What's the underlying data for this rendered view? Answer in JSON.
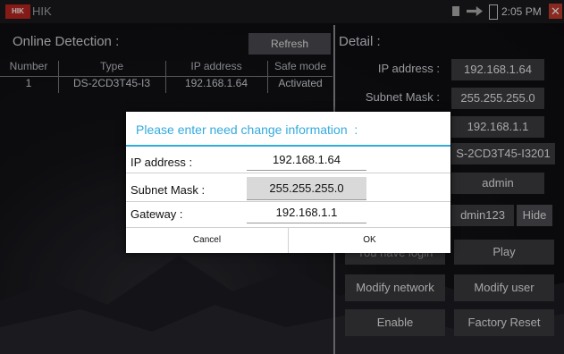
{
  "status_bar": {
    "app_name": "HIK",
    "logo_text": "HIK",
    "time": "2:05 PM"
  },
  "left_panel": {
    "title": "Online Detection :",
    "refresh_label": "Refresh",
    "columns": [
      "Number",
      "Type",
      "IP address",
      "Safe mode"
    ],
    "rows": [
      {
        "number": "1",
        "type": "DS-2CD3T45-I3",
        "ip": "192.168.1.64",
        "safe_mode": "Activated"
      }
    ]
  },
  "detail": {
    "title": "Detail :",
    "ip_label": "IP address :",
    "ip_value": "192.168.1.64",
    "mask_label": "Subnet Mask :",
    "mask_value": "255.255.255.0",
    "gateway_value": "192.168.1.1",
    "device_value": "S-2CD3T45-I3201",
    "user_value": "admin",
    "password_value": "dmin123",
    "hide_label": "Hide",
    "login_status": "You have login",
    "play_label": "Play",
    "modify_network_label": "Modify network",
    "modify_user_label": "Modify user",
    "enable_label": "Enable",
    "factory_reset_label": "Factory Reset"
  },
  "dialog": {
    "title": "Please enter need change information  :",
    "ip_label": "IP address :",
    "ip_value": "192.168.1.64",
    "mask_label": "Subnet Mask :",
    "mask_value": "255.255.255.0",
    "gateway_label": "Gateway :",
    "gateway_value": "192.168.1.1",
    "cancel_label": "Cancel",
    "ok_label": "OK"
  },
  "colors": {
    "accent": "#33aadd",
    "close": "#c0392b",
    "logo": "#b7261f"
  },
  "icons": [
    "sd-card-icon",
    "usb-icon",
    "battery-icon",
    "close-icon"
  ]
}
